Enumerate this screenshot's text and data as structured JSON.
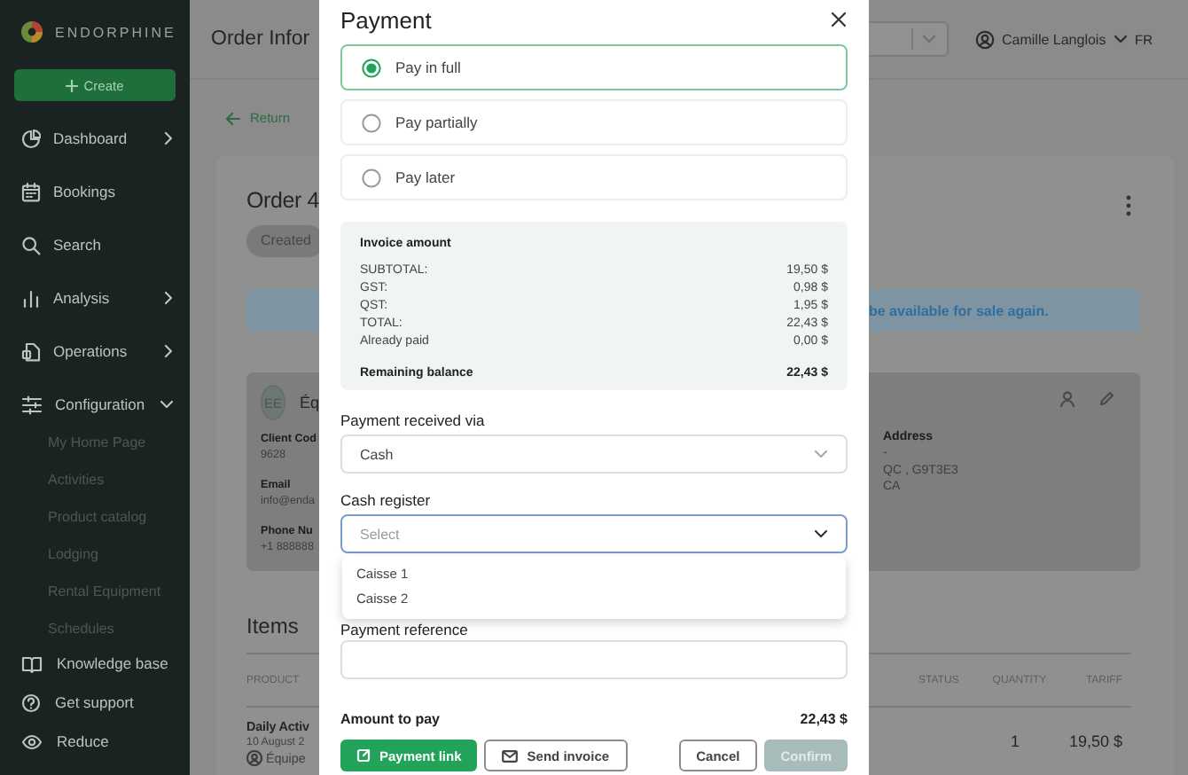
{
  "sidebar": {
    "brand": "ENDORPHINE",
    "create_button": "Create",
    "items": [
      {
        "label": "Dashboard",
        "kind": "group",
        "expanded": false
      },
      {
        "label": "Bookings",
        "kind": "link"
      },
      {
        "label": "Search",
        "kind": "link"
      },
      {
        "label": "Analysis",
        "kind": "group",
        "expanded": false
      },
      {
        "label": "Operations",
        "kind": "group",
        "expanded": false
      },
      {
        "label": "Configuration",
        "kind": "group",
        "expanded": true,
        "children": [
          {
            "label": "My Home Page"
          },
          {
            "label": "Activities"
          },
          {
            "label": "Product catalog"
          },
          {
            "label": "Lodging"
          },
          {
            "label": "Rental Equipment"
          },
          {
            "label": "Schedules"
          }
        ]
      }
    ],
    "footer_items": [
      {
        "label": "Knowledge base"
      },
      {
        "label": "Get support"
      },
      {
        "label": "Reduce"
      }
    ]
  },
  "header": {
    "page_title": "Order Infor",
    "user": "Camille Langlois",
    "language": "FR"
  },
  "order": {
    "return_link": "Return",
    "title": "Order 4",
    "status": "Created",
    "notice": "be available for sale again.",
    "client": {
      "avatar": "EE",
      "name": "Éq",
      "fields": [
        {
          "label": "Client Cod",
          "value": "9628"
        },
        {
          "label": "Email",
          "value": "info@enda"
        },
        {
          "label": "Phone Nu",
          "value": "+1 888888"
        }
      ]
    },
    "address": {
      "label": "Address",
      "lines": [
        "-",
        "QC , G9T3E3",
        "CA"
      ]
    },
    "items": {
      "title": "Items",
      "columns": [
        "PRODUCT",
        "STATUS",
        "QUANTITY",
        "TARIFF"
      ],
      "rows": [
        {
          "product": "Daily Activ",
          "date": "10 August 2",
          "resource": "Équipe",
          "quantity": "1",
          "tariff": "19,50 $"
        }
      ]
    }
  },
  "payment_dialog": {
    "title": "Payment",
    "options": [
      {
        "label": "Pay in full",
        "selected": true
      },
      {
        "label": "Pay partially",
        "selected": false
      },
      {
        "label": "Pay later",
        "selected": false
      }
    ],
    "invoice": {
      "title": "Invoice amount",
      "lines": [
        {
          "label": "SUBTOTAL:",
          "value": "19,50 $"
        },
        {
          "label": "GST:",
          "value": "0,98 $"
        },
        {
          "label": "QST:",
          "value": "1,95 $"
        },
        {
          "label": "TOTAL:",
          "value": "22,43 $"
        },
        {
          "label": "Already paid",
          "value": "0,00 $"
        }
      ],
      "balance": {
        "label": "Remaining balance",
        "value": "22,43 $"
      }
    },
    "payment_method": {
      "label": "Payment received via",
      "value": "Cash"
    },
    "cash_register": {
      "label": "Cash register",
      "placeholder": "Select",
      "expanded": true,
      "options": [
        "Caisse 1",
        "Caisse 2"
      ]
    },
    "payment_reference": {
      "label": "Payment reference"
    },
    "amount_to_pay": {
      "label": "Amount to pay",
      "value": "22,43 $"
    },
    "left_buttons": [
      {
        "label": "Payment link",
        "kind": "primary",
        "disabled": false
      },
      {
        "label": "Send invoice",
        "kind": "outline",
        "disabled": false
      }
    ],
    "right_buttons": [
      {
        "label": "Cancel",
        "kind": "outline",
        "disabled": false
      },
      {
        "label": "Confirm",
        "kind": "primary",
        "disabled": true
      }
    ]
  }
}
